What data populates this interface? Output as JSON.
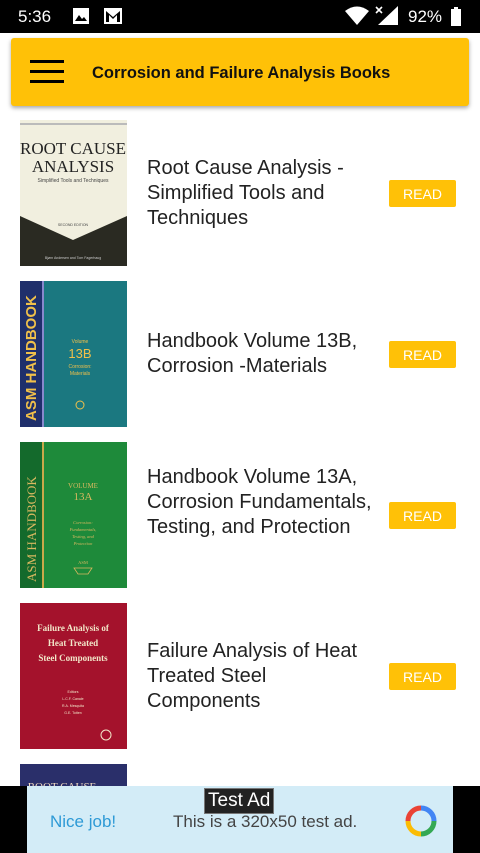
{
  "status_bar": {
    "time": "5:36",
    "battery": "92%",
    "icons": [
      "image-icon",
      "gmail-icon",
      "wifi-icon",
      "signal-icon",
      "battery-icon"
    ]
  },
  "app_bar": {
    "title": "Corrosion and Failure Analysis Books",
    "menu_icon": "hamburger-menu-icon",
    "background": "#FFC107"
  },
  "books": [
    {
      "title": "Root Cause Analysis - Simplified Tools and Techniques",
      "read_label": "READ"
    },
    {
      "title": "Handbook Volume 13B, Corrosion -Materials",
      "read_label": "READ"
    },
    {
      "title": "Handbook Volume 13A, Corrosion Fundamentals, Testing, and Protection",
      "read_label": "READ"
    },
    {
      "title": "Failure Analysis of Heat Treated Steel Components",
      "read_label": "READ"
    }
  ],
  "covers": {
    "c1": {
      "title": "ROOT CAUSE ANALYSIS",
      "subtitle": "Simplified Tools and Techniques",
      "edition": "SECOND EDITION",
      "authors": "Bjørn Andersen and Tom Fagerhaug"
    },
    "c2": {
      "spine": "ASM HANDBOOK",
      "volume_label": "Volume",
      "volume": "13B",
      "subject": "Corrosion: Materials"
    },
    "c3": {
      "spine": "ASM HANDBOOK",
      "volume_label": "VOLUME",
      "volume": "13A",
      "subject": "Corrosion: Fundamentals, Testing, and Protection",
      "publisher": "ASM"
    },
    "c4": {
      "title": "Failure Analysis of Heat Treated Steel Components",
      "editors": "Editors L.C.F. Canale R.A. Mesquita G.E. Totten"
    },
    "c5": {
      "title": "ROOT CAUSE"
    }
  },
  "ad": {
    "tag": "Test Ad",
    "nice": "Nice job!",
    "text": "This is a 320x50 test ad."
  },
  "colors": {
    "accent": "#FFC107",
    "ad_bg": "#d3ecf7",
    "nice": "#2e9ad6"
  }
}
